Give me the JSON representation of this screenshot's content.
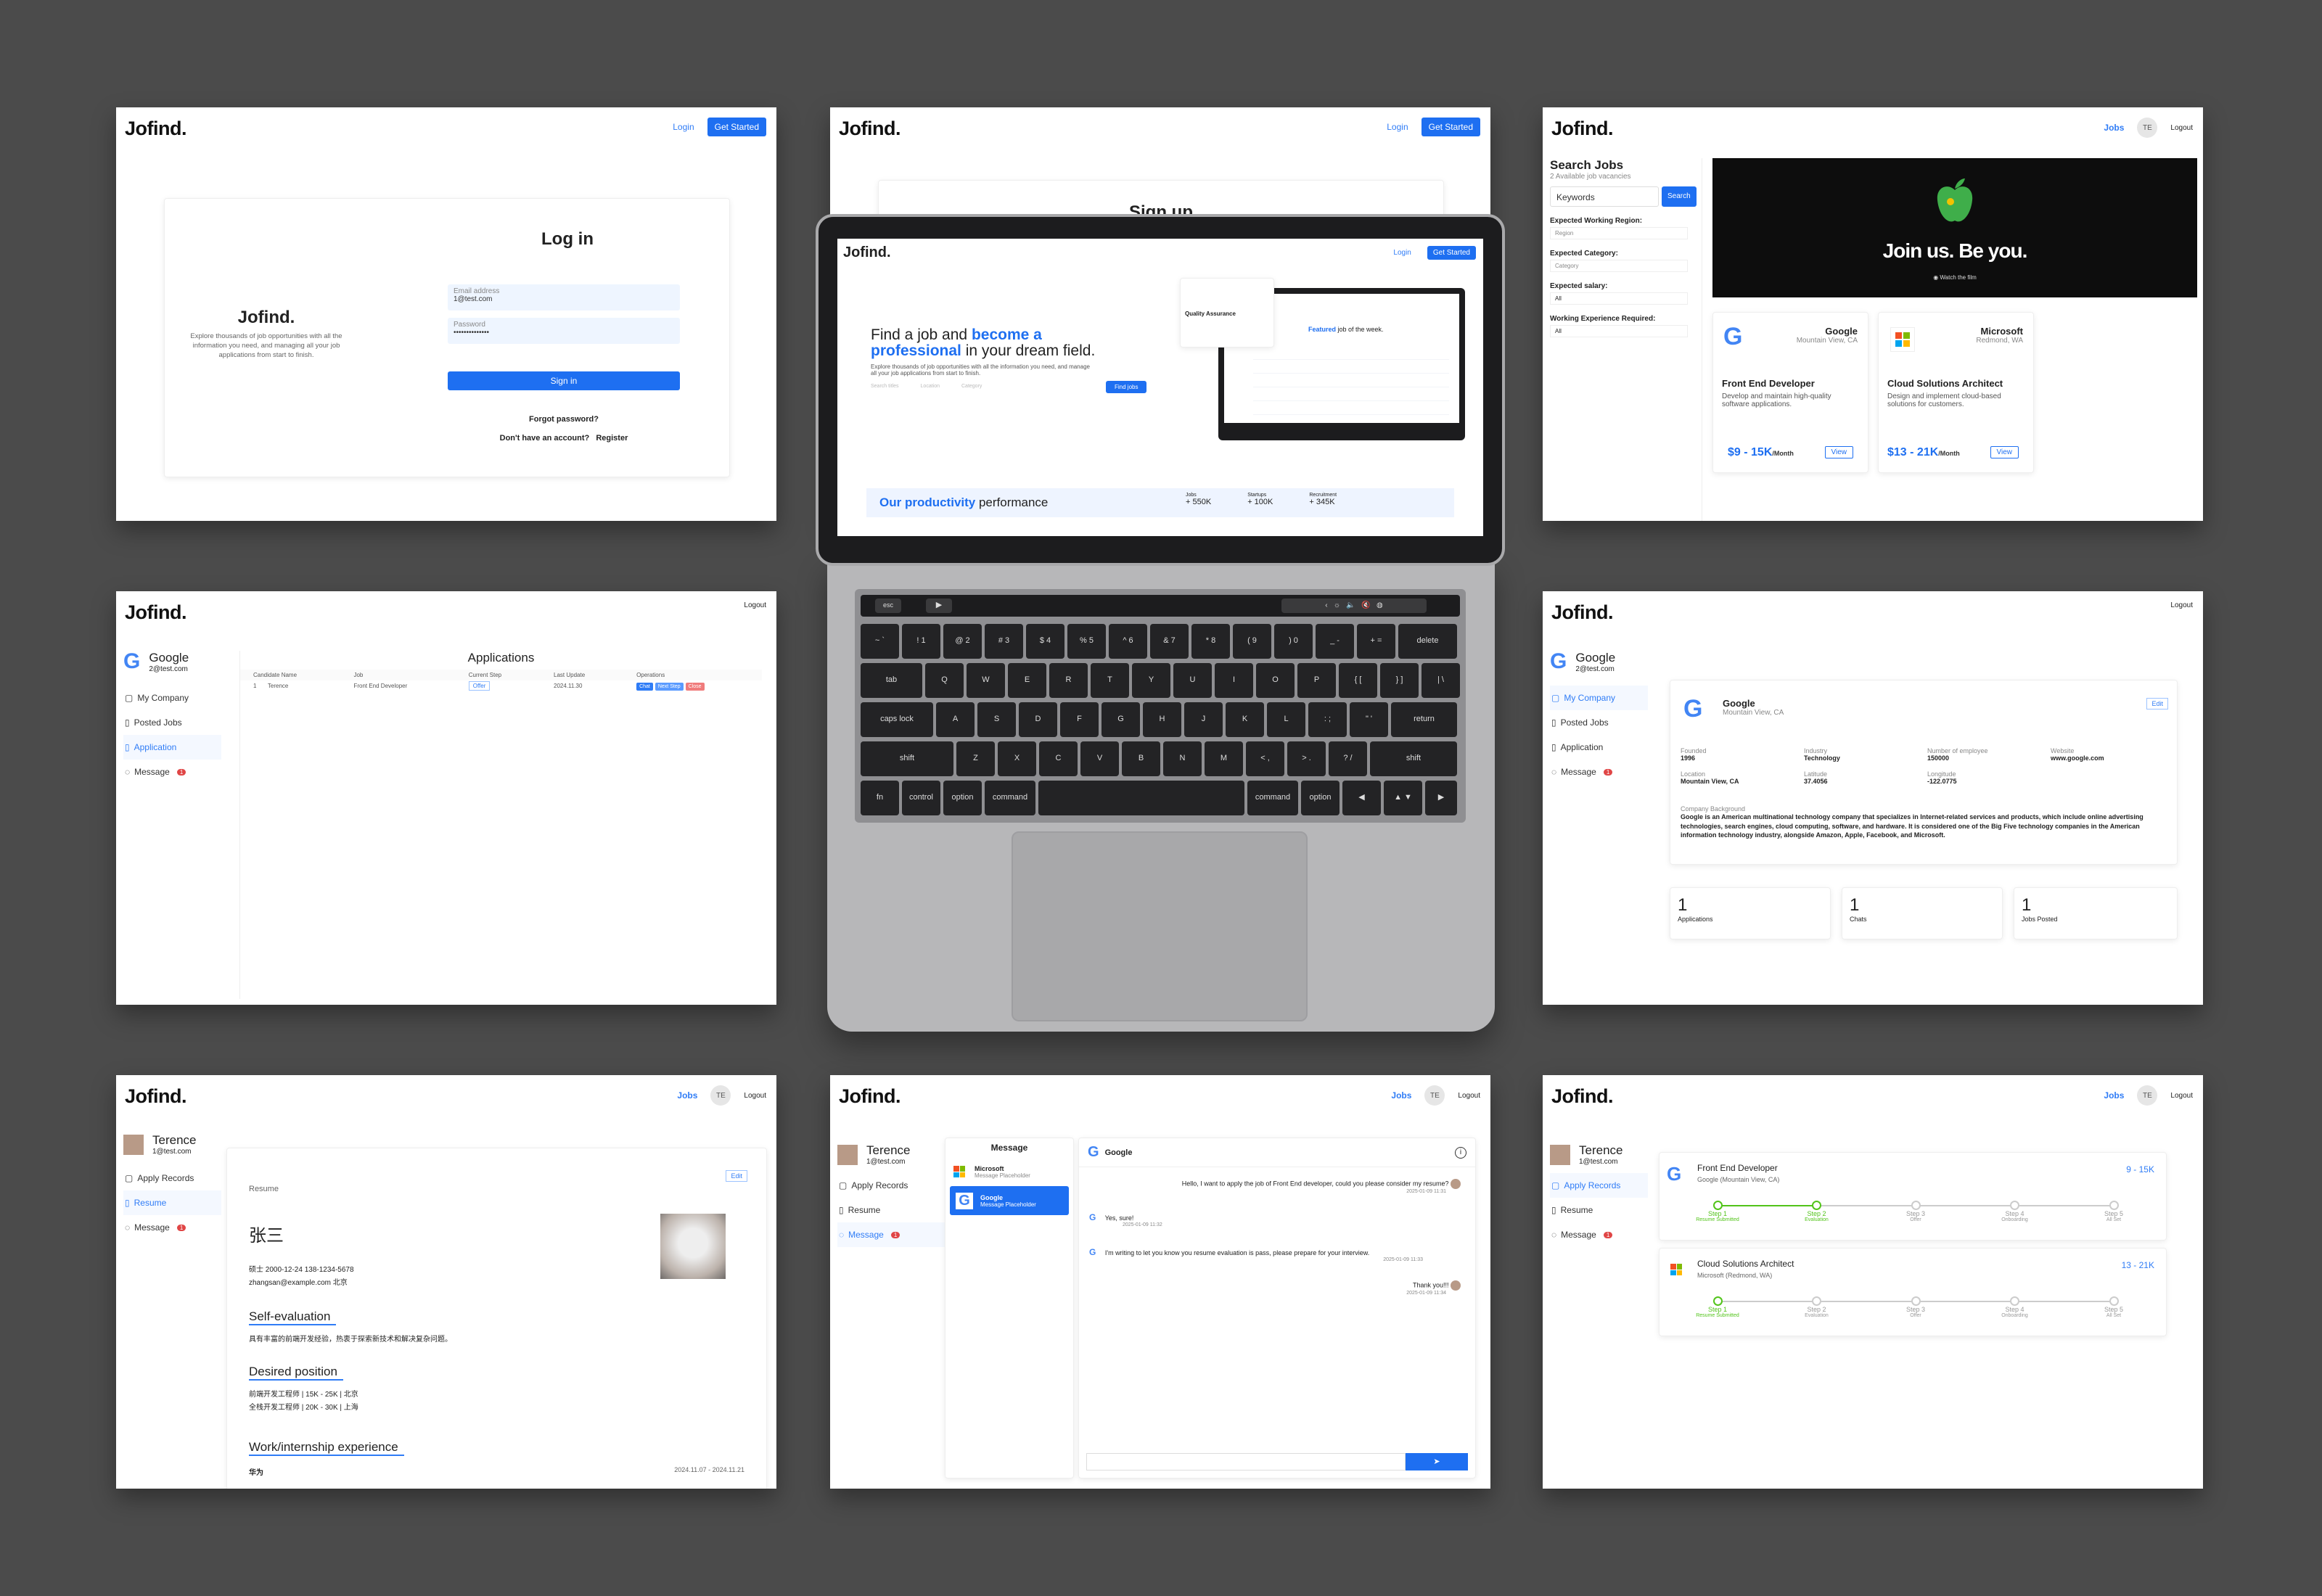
{
  "brand": {
    "name": "Jofind.",
    "accent": "#1e6ff1",
    "tagline": "Explore thousands of job opportunities with all the information you need, and managing all your job applications from start to finish."
  },
  "nav": {
    "login": "Login",
    "get_started": "Get Started",
    "jobs": "Jobs",
    "avatar": "TE",
    "logout": "Logout"
  },
  "login": {
    "title": "Log in",
    "email_label": "Email address",
    "email_value": "1@test.com",
    "password_label": "Password",
    "password_value": "••••••••••••••",
    "sign_in": "Sign in",
    "forgot": "Forgot password?",
    "no_account": "Don't have an account?",
    "register": "Register"
  },
  "signup": {
    "title": "Sign up"
  },
  "search": {
    "title": "Search Jobs",
    "count": "2 Available job vacancies",
    "keywords_placeholder": "Keywords",
    "search_button": "Search",
    "region_label": "Expected Working Region:",
    "region_placeholder": "Region",
    "category_label": "Expected Category:",
    "category_placeholder": "Category",
    "salary_label": "Expected salary:",
    "salary_value": "All",
    "experience_label": "Working Experience Required:",
    "experience_value": "All"
  },
  "banner": {
    "headline": "Join us. Be you.",
    "sub": "Watch the film"
  },
  "jobs": [
    {
      "company": "Google",
      "location": "Mountain View, CA",
      "title": "Front End Developer",
      "desc": "Develop and maintain high-quality software applications.",
      "salary": "$9 - 15K",
      "per": "/Month",
      "view": "View"
    },
    {
      "company": "Microsoft",
      "location": "Redmond, WA",
      "title": "Cloud Solutions Architect",
      "desc": "Design and implement cloud-based solutions for customers.",
      "salary": "$13 - 21K",
      "per": "/Month",
      "view": "View"
    }
  ],
  "company_side": {
    "name": "Google",
    "email": "2@test.com",
    "items": [
      "My Company",
      "Posted Jobs",
      "Application",
      "Message"
    ]
  },
  "applications": {
    "title": "Applications",
    "columns": [
      "Candidate Name",
      "Job",
      "Current Step",
      "Last Update",
      "Operations"
    ],
    "row": {
      "index": "1",
      "name": "Terence",
      "job": "Front End Developer",
      "step": "Offer",
      "date": "2024.11.30"
    },
    "ops": [
      "Chat",
      "Next Step",
      "Close"
    ]
  },
  "company_profile": {
    "name": "Google",
    "location": "Mountain View, CA",
    "edit": "Edit",
    "fields": [
      {
        "label": "Founded",
        "value": "1996"
      },
      {
        "label": "Industry",
        "value": "Technology"
      },
      {
        "label": "Number of employee",
        "value": "150000"
      },
      {
        "label": "Website",
        "value": "www.google.com"
      },
      {
        "label": "Location",
        "value": "Mountain View, CA"
      },
      {
        "label": "Latitude",
        "value": "37.4056"
      },
      {
        "label": "Longitude",
        "value": "-122.0775"
      }
    ],
    "bg_label": "Company Background",
    "bg_text": "Google is an American multinational technology company that specializes in Internet-related services and products, which include online advertising technologies, search engines, cloud computing, software, and hardware. It is considered one of the Big Five technology companies in the American information technology industry, alongside Amazon, Apple, Facebook, and Microsoft.",
    "stats": [
      {
        "value": "1",
        "label": "Applications"
      },
      {
        "value": "1",
        "label": "Chats"
      },
      {
        "value": "1",
        "label": "Jobs Posted"
      }
    ]
  },
  "user_side": {
    "name": "Terence",
    "email": "1@test.com",
    "items": [
      "Apply Records",
      "Resume",
      "Message"
    ]
  },
  "resume": {
    "label": "Resume",
    "edit": "Edit",
    "name": "张三",
    "meta1": "硕士   2000-12-24   138-1234-5678",
    "meta2": "zhangsan@example.com   北京",
    "self_title": "Self-evaluation",
    "self_text": "具有丰富的前端开发经验，热衷于探索新技术和解决复杂问题。",
    "desired_title": "Desired position",
    "desired_1": "前端开发工程师 | 15K - 25K | 北京",
    "desired_2": "全栈开发工程师 | 20K - 30K | 上海",
    "work_title": "Work/internship experience",
    "work_company": "华为",
    "work_date": "2024.11.07 - 2024.11.21"
  },
  "chat": {
    "list_title": "Message",
    "threads": [
      {
        "name": "Microsoft",
        "preview": "Message Placeholder"
      },
      {
        "name": "Google",
        "preview": "Message Placeholder"
      }
    ],
    "header": "Google",
    "messages": [
      {
        "side": "right",
        "text": "Hello, I want to apply the job of Front End developer, could you please consider my resume?",
        "time": "2025-01-09 11:31"
      },
      {
        "side": "left",
        "text": "Yes, sure!",
        "time": "2025-01-09 11:32"
      },
      {
        "side": "left",
        "text": "I'm writing to let you know you resume evaluation is pass, please prepare for your interview.",
        "time": "2025-01-09 11:33"
      },
      {
        "side": "right",
        "text": "Thank you!!!",
        "time": "2025-01-09 11:34"
      }
    ]
  },
  "records": [
    {
      "title": "Front End Developer",
      "company": "Google (Mountain View, CA)",
      "salary": "9 - 15K",
      "active": 2
    },
    {
      "title": "Cloud Solutions Architect",
      "company": "Microsoft (Redmond, WA)",
      "salary": "13 - 21K",
      "active": 1
    }
  ],
  "steps": [
    {
      "name": "Step 1",
      "sub": "Resume Submitted"
    },
    {
      "name": "Step 2",
      "sub": "Evaluation"
    },
    {
      "name": "Step 3",
      "sub": "Offer"
    },
    {
      "name": "Step 4",
      "sub": "Onboarding"
    },
    {
      "name": "Step 5",
      "sub": "All Set"
    }
  ],
  "hero": {
    "line1a": "Find a job and ",
    "line1b": "become a",
    "line2a": "professional",
    "line2b": " in your dream field.",
    "desc": "Explore thousands of job opportunities with all the information you need, and manage all your job applications from start to finish.",
    "ph_title": "Search titles",
    "ph_location": "Location",
    "ph_category": "Category",
    "find": "Find jobs",
    "featured": "Featured",
    "featured_rest": " job of the week.",
    "card_title": "Quality Assurance",
    "prod_a": "Our productivity",
    "prod_b": " performance",
    "stats": [
      {
        "label": "Jobs",
        "value": "550K"
      },
      {
        "label": "Startups",
        "value": "100K"
      },
      {
        "label": "Recruitment",
        "value": "345K"
      }
    ]
  },
  "keyboard": {
    "esc": "esc",
    "row1": [
      "~ `",
      "! 1",
      "@ 2",
      "# 3",
      "$ 4",
      "% 5",
      "^ 6",
      "& 7",
      "* 8",
      "( 9",
      ") 0",
      "_ -",
      "+ ="
    ],
    "delete": "delete",
    "tab": "tab",
    "row2": [
      "Q",
      "W",
      "E",
      "R",
      "T",
      "Y",
      "U",
      "I",
      "O",
      "P",
      "{ [",
      "} ]",
      "| \\"
    ],
    "caps": "caps lock",
    "row3": [
      "A",
      "S",
      "D",
      "F",
      "G",
      "H",
      "J",
      "K",
      "L",
      ": ;",
      "\" '"
    ],
    "return": "return",
    "shift": "shift",
    "row4": [
      "Z",
      "X",
      "C",
      "V",
      "B",
      "N",
      "M",
      "< ,",
      "> .",
      "? /"
    ],
    "fn": "fn",
    "control": "control",
    "option": "option",
    "command": "command"
  }
}
